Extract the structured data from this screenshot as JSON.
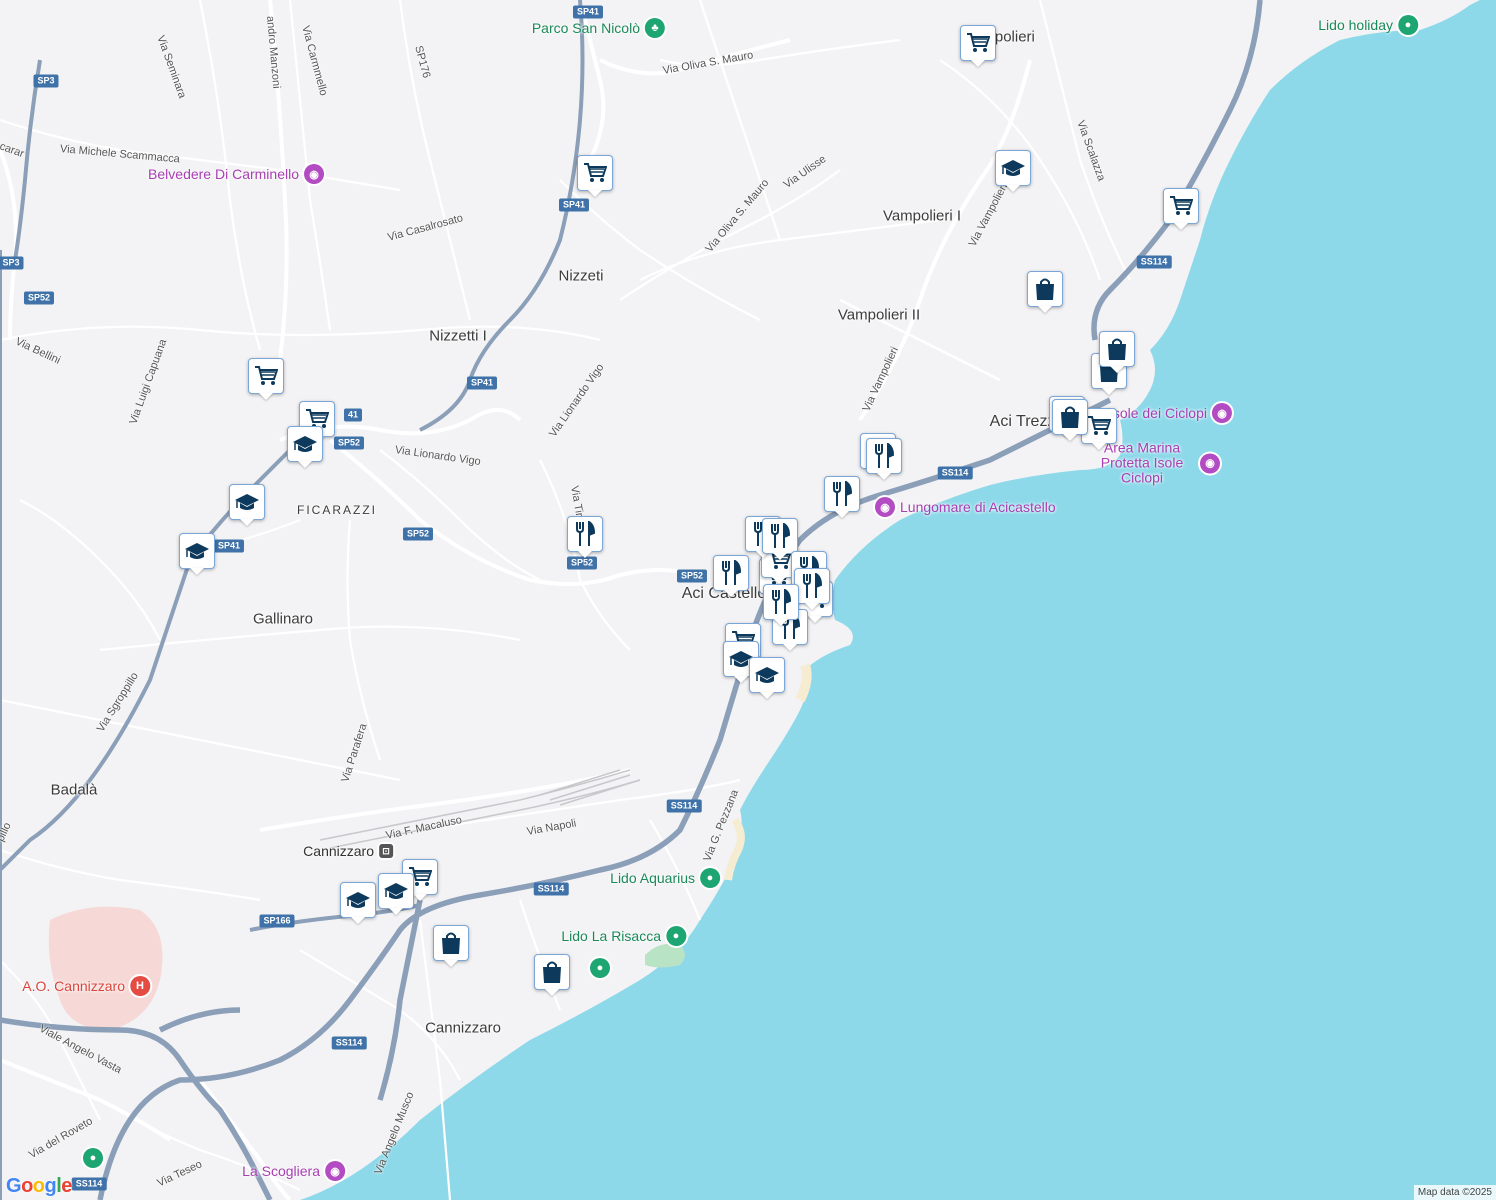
{
  "colors": {
    "land": "#f3f3f5",
    "sea": "#8dd9ea",
    "road": "#ffffff",
    "highway": "#8b9fb8",
    "marker_border": "#7aa6d8",
    "marker_icon": "#0d3a5c"
  },
  "places": [
    "Nizzeti",
    "Nizzetti I",
    "FICARAZZI",
    "Gallinaro",
    "Badalà",
    "Cannizzaro",
    "Cannizzaro",
    "Aci Castello",
    "Aci Trezza",
    "Vampolieri",
    "Vampolieri I",
    "Vampolieri II"
  ],
  "streets": [
    "Via Seminara",
    "Via Carmmello",
    "andro Manzoni",
    "SP176",
    "Via Michele Scammacca",
    "Via Casalrosato",
    "Via Oliva S. Mauro",
    "Via Oliva S. Mauro",
    "Via Ulisse",
    "Via Vampolieri",
    "Via Vampolieri",
    "Via Scalazza",
    "Via Bellini",
    "Via Luigi Capuana",
    "Via Lionardo Vigo",
    "Via Lionardo Vigo",
    "Via Tir",
    "Via Sgroppillo",
    "Via Parafera",
    "Via F. Macaluso",
    "Via Napoli",
    "Via G. Pezzana",
    "Viale Angelo Vasta",
    "Via del Roveto",
    "Via Teseo",
    "Via Angelo Musco",
    "pillo",
    "carar"
  ],
  "shields": [
    "SP41",
    "SP3",
    "SP41",
    "SP3",
    "SP52",
    "SP41",
    "SP52",
    "SP41",
    "SP52",
    "SP52",
    "SP52",
    "SS114",
    "SS114",
    "SP166",
    "SS114",
    "SS114",
    "SS114",
    "41"
  ],
  "pois": [
    {
      "label": "Parco San Nicolò",
      "type": "park",
      "icon": "tree-icon"
    },
    {
      "label": "Belvedere Di Carminello",
      "type": "attraction",
      "icon": "camera-icon"
    },
    {
      "label": "Lido holiday",
      "type": "beach",
      "icon": "beach-icon"
    },
    {
      "label": "Isole dei Ciclopi",
      "type": "attraction",
      "icon": "camera-icon"
    },
    {
      "label": "Area Marina Protetta Isole Ciclopi",
      "type": "attraction",
      "icon": "camera-icon"
    },
    {
      "label": "Lungomare di Acicastello",
      "type": "attraction",
      "icon": "camera-icon"
    },
    {
      "label": "Lido Aquarius",
      "type": "beach",
      "icon": "beach-icon"
    },
    {
      "label": "Lido La Risacca",
      "type": "beach",
      "icon": "beach-icon"
    },
    {
      "label": "",
      "type": "beach",
      "icon": "beach-icon"
    },
    {
      "label": "A.O. Cannizzaro",
      "type": "hospital",
      "icon": "hospital-icon"
    },
    {
      "label": "La Scogliera",
      "type": "attraction",
      "icon": "camera-icon"
    },
    {
      "label": "",
      "type": "beach",
      "icon": "beach-icon"
    },
    {
      "label": "Cannizzaro",
      "type": "station",
      "icon": "train-icon"
    }
  ],
  "markers": [
    "grocery",
    "grocery",
    "grocery",
    "grocery",
    "grocery",
    "grocery",
    "grocery",
    "grocery",
    "grocery",
    "grocery",
    "grocery",
    "grocery",
    "school",
    "school",
    "school",
    "school",
    "school",
    "school",
    "school",
    "school",
    "restaurant",
    "restaurant",
    "restaurant",
    "restaurant",
    "restaurant",
    "restaurant",
    "restaurant",
    "restaurant",
    "restaurant",
    "restaurant",
    "restaurant",
    "shopping",
    "shopping",
    "shopping",
    "shopping",
    "shopping",
    "shopping"
  ],
  "branding": {
    "logo": "Google",
    "attribution": "Map data ©2025"
  }
}
